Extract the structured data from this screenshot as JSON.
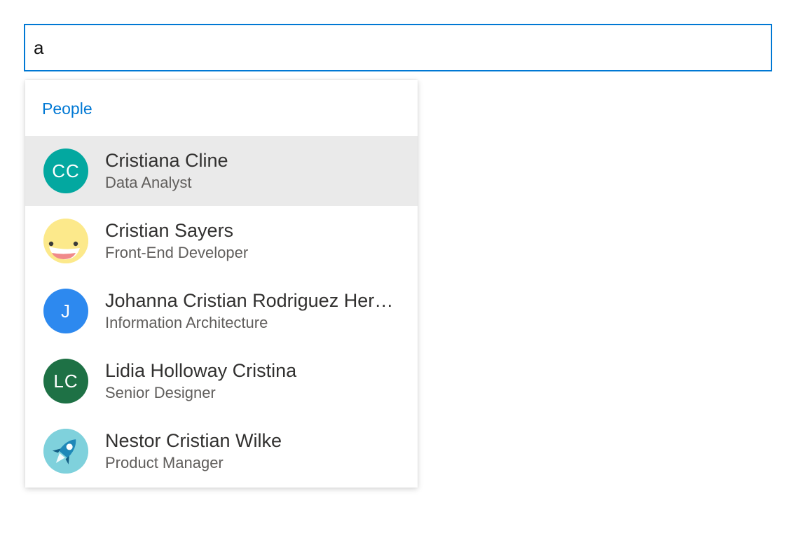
{
  "search": {
    "value": "a",
    "focus_color": "#0078d4"
  },
  "dropdown": {
    "section_title": "People",
    "people": [
      {
        "name": "Cristiana Cline",
        "role": "Data Analyst",
        "initials": "CC",
        "avatar_color": "#03a8a0",
        "avatar_type": "initials",
        "selected": true
      },
      {
        "name": "Cristian Sayers",
        "role": "Front-End Developer",
        "initials": "",
        "avatar_color": "#fce98b",
        "avatar_type": "laughing-face-icon",
        "selected": false
      },
      {
        "name": "Johanna Cristian Rodriguez Hern…",
        "role": "Information Architecture",
        "initials": "J",
        "avatar_color": "#2d89ef",
        "avatar_type": "initials",
        "selected": false
      },
      {
        "name": "Lidia Holloway Cristina",
        "role": "Senior Designer",
        "initials": "LC",
        "avatar_color": "#1e7145",
        "avatar_type": "initials",
        "selected": false
      },
      {
        "name": "Nestor Cristian Wilke",
        "role": "Product Manager",
        "initials": "",
        "avatar_color": "#7fd1dc",
        "avatar_type": "rocket-icon",
        "selected": false
      }
    ]
  }
}
